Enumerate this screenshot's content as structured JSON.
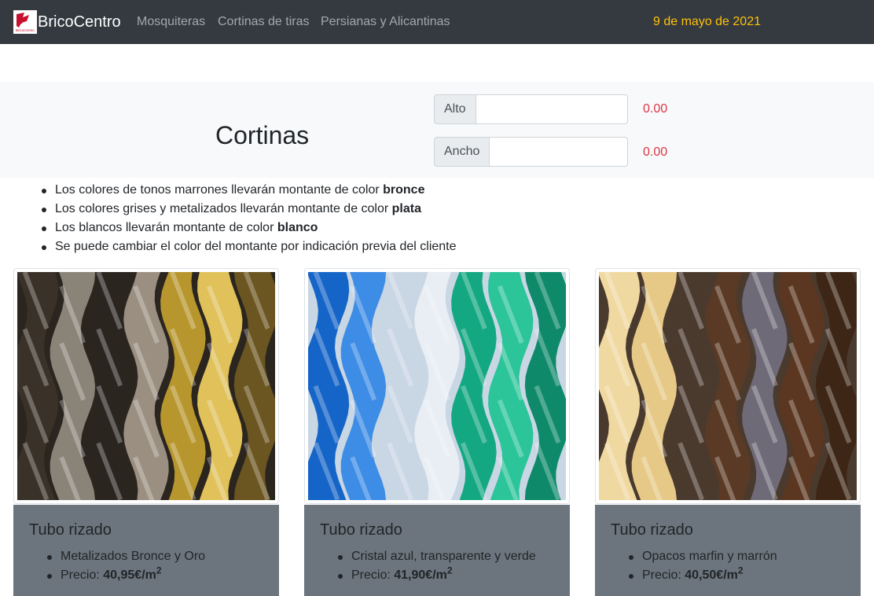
{
  "nav": {
    "brand": "BricoCentro",
    "logo_text": "BricoCentro",
    "links": [
      "Mosquiteras",
      "Cortinas de tiras",
      "Persianas y Alicantinas"
    ],
    "date": "9 de mayo de 2021"
  },
  "header": {
    "title": "Cortinas",
    "alto_label": "Alto",
    "alto_value": "",
    "ancho_label": "Ancho",
    "ancho_value": "",
    "alto_result": "0.00",
    "ancho_result": "0.00"
  },
  "notes": [
    {
      "text": "Los colores de tonos marrones llevarán montante de color ",
      "bold": "bronce"
    },
    {
      "text": "Los colores grises y metalizados llevarán montante de color ",
      "bold": "plata"
    },
    {
      "text": "Los blancos llevarán montante de color ",
      "bold": "blanco"
    },
    {
      "text": "Se puede cambiar el color del montante por indicación previa del cliente",
      "bold": ""
    }
  ],
  "cards": [
    {
      "title": "Tubo rizado",
      "description": "Metalizados Bronce y Oro",
      "price_label": "Precio: ",
      "price": "40,95€/m",
      "price_sup": "2",
      "image_icon": "twisted-tube-bronze-gold-photo",
      "colors": [
        "#3a3128",
        "#8a8478",
        "#2b2520",
        "#9a8f80",
        "#b8962e",
        "#e0c15a",
        "#6b5520"
      ]
    },
    {
      "title": "Tubo rizado",
      "description": "Cristal azul, transparente y verde",
      "price_label": "Precio: ",
      "price": "41,90€/m",
      "price_sup": "2",
      "image_icon": "twisted-tube-blue-clear-green-photo",
      "colors": [
        "#1565c8",
        "#3d8de6",
        "#c9d6e4",
        "#e8eef4",
        "#14a882",
        "#2cc59a",
        "#0e8a6a"
      ]
    },
    {
      "title": "Tubo rizado",
      "description": "Opacos marfin y marrón",
      "price_label": "Precio: ",
      "price": "40,50€/m",
      "price_sup": "2",
      "image_icon": "twisted-tube-ivory-brown-photo",
      "colors": [
        "#f0d9a0",
        "#e6c987",
        "#4a3a2e",
        "#5a3a24",
        "#6e6a78",
        "#5b3620",
        "#3e2616"
      ]
    }
  ]
}
